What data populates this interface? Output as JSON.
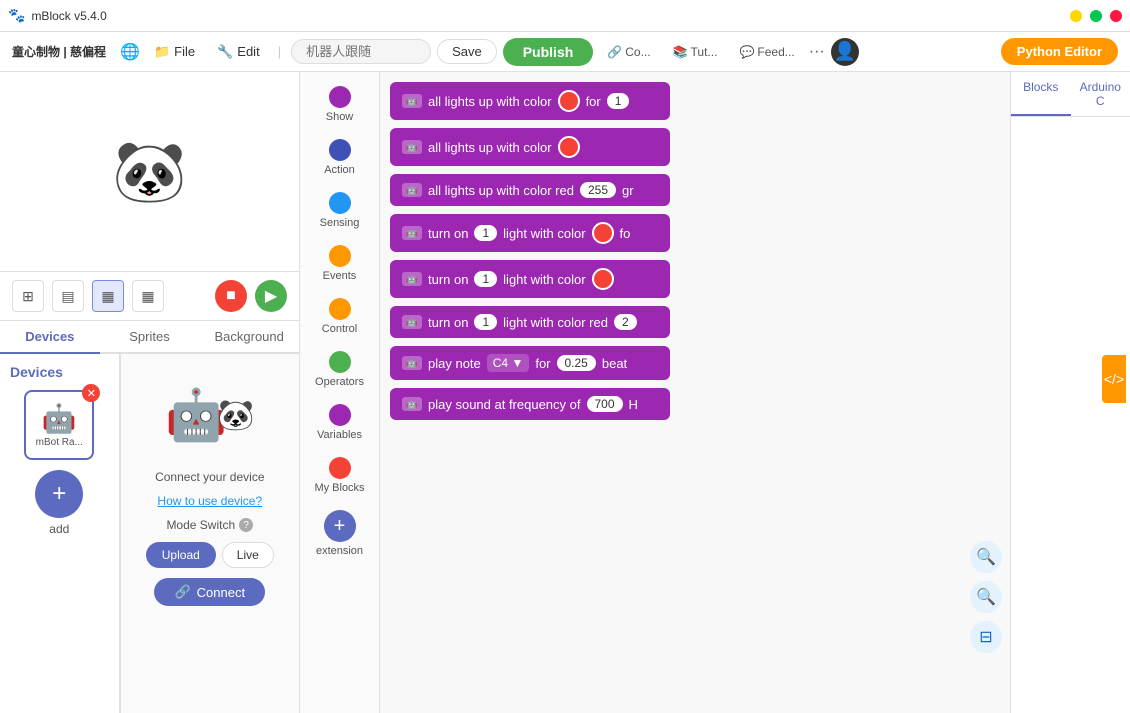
{
  "app": {
    "title": "mBlock v5.4.0"
  },
  "menubar": {
    "brand": "童心制物 | 慈偏程",
    "items": [
      "File",
      "Edit"
    ],
    "search_placeholder": "机器人跟随",
    "save_label": "Save",
    "publish_label": "Publish",
    "connect_label": "Co...",
    "tutorial_label": "Tut...",
    "feedback_label": "Feed...",
    "python_editor_label": "Python Editor"
  },
  "tabs": {
    "blocks_label": "Blocks",
    "arduino_label": "Arduino C"
  },
  "left": {
    "tabs": [
      "Devices",
      "Sprites",
      "Background"
    ],
    "active_tab": "Devices",
    "device_name": "mBot Ra...",
    "add_label": "add",
    "connect_device_text": "Connect your device",
    "how_to_label": "How to use device?",
    "mode_switch_label": "Mode Switch",
    "upload_label": "Upload",
    "live_label": "Live",
    "connect_btn_label": "Connect"
  },
  "categories": [
    {
      "label": "Show",
      "color": "#9C27B0"
    },
    {
      "label": "Action",
      "color": "#3F51B5"
    },
    {
      "label": "Sensing",
      "color": "#2196F3"
    },
    {
      "label": "Events",
      "color": "#FF9800"
    },
    {
      "label": "Control",
      "color": "#FF9800"
    },
    {
      "label": "Operators",
      "color": "#4CAF50"
    },
    {
      "label": "Variables",
      "color": "#9C27B0"
    },
    {
      "label": "My Blocks",
      "color": "#f44336"
    }
  ],
  "blocks": [
    {
      "text": "all lights up with color",
      "has_color": true,
      "color_val": "#f44336",
      "has_for": true,
      "for_val": "1",
      "type": "normal"
    },
    {
      "text": "all lights up with color",
      "has_color": true,
      "color_val": "#f44336",
      "type": "short"
    },
    {
      "text": "all lights up with color red",
      "has_num": true,
      "num_val": "255",
      "has_suffix": true,
      "suffix": "gr",
      "type": "red"
    },
    {
      "text": "turn on",
      "num_val": "1",
      "mid_text": "light with color",
      "has_color": true,
      "color_val": "#f44336",
      "has_for": true,
      "type": "turn"
    },
    {
      "text": "turn on",
      "num_val": "1",
      "mid_text": "light with color",
      "has_color": true,
      "color_val": "#f44336",
      "type": "turn-short"
    },
    {
      "text": "turn on",
      "num_val": "1",
      "mid_text": "light with color red",
      "has_num2": true,
      "num2_val": "2",
      "type": "turn-red"
    },
    {
      "text": "play note",
      "dropdown": "C4",
      "for_text": "for",
      "beat_val": "0.25",
      "beat_suffix": "beat",
      "type": "note"
    },
    {
      "text": "play sound at frequency of",
      "freq_val": "700",
      "suffix": "H",
      "type": "freq"
    }
  ],
  "scroll_tools": {
    "zoom_in": "+",
    "zoom_out": "-",
    "fit": "⊙"
  }
}
